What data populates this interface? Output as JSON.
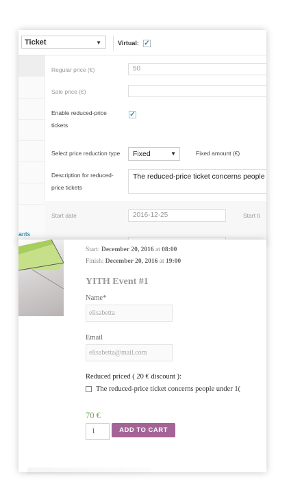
{
  "admin": {
    "product_type": "Ticket",
    "virtual_label": "Virtual:",
    "virtual_checked": "✓",
    "fields": {
      "regular_price_label": "Regular price (€)",
      "regular_price_value": "50",
      "sale_price_label": "Sale price (€)",
      "sale_price_value": "",
      "enable_reduced_label": "Enable reduced-price tickets",
      "enable_reduced_checked": "✓",
      "reduction_type_label": "Select price reduction type",
      "reduction_type_value": "Fixed",
      "fixed_amount_label": "Fixed amount (€)",
      "description_label": "Description for reduced-price tickets",
      "description_value": "The reduced-price ticket concerns people",
      "start_date_label": "Start date",
      "start_date_value": "2016-12-25",
      "start_time_label": "Start ti"
    },
    "left_link": "ants"
  },
  "front": {
    "start_label": "Start:",
    "start_date": "December 20, 2016",
    "start_at": "at",
    "start_time": "08:00",
    "finish_label": "Finish:",
    "finish_date": "December 20, 2016",
    "finish_at": "at",
    "finish_time": "19:00",
    "title": "YITH Event #1",
    "name_label": "Name*",
    "name_value": "elisabetta",
    "email_label": "Email",
    "email_value": "elisabetta@mail.com",
    "reduced_title": "Reduced priced ( 20 € discount ):",
    "reduced_option": "The reduced-price ticket concerns people under 1(",
    "price": "70 €",
    "quantity": "1",
    "add_to_cart": "ADD TO CART"
  },
  "colors": {
    "accent_blue": "#1e8cbe",
    "cart_button": "#a46497",
    "price_green": "#77a464"
  }
}
